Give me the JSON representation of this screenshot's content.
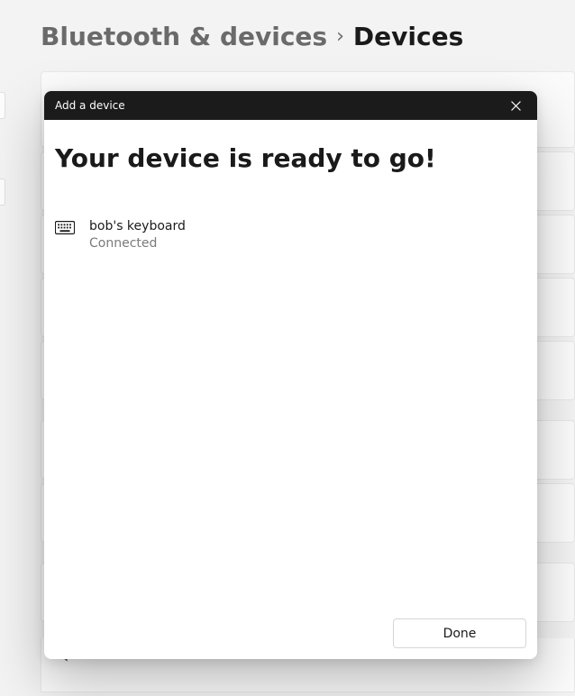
{
  "breadcrumb": {
    "parent": "Bluetooth & devices",
    "separator": "›",
    "current": "Devices"
  },
  "modal": {
    "titlebar": "Add a device",
    "heading": "Your device is ready to go!",
    "device": {
      "name": "bob's keyboard",
      "status": "Connected"
    },
    "done_label": "Done"
  }
}
